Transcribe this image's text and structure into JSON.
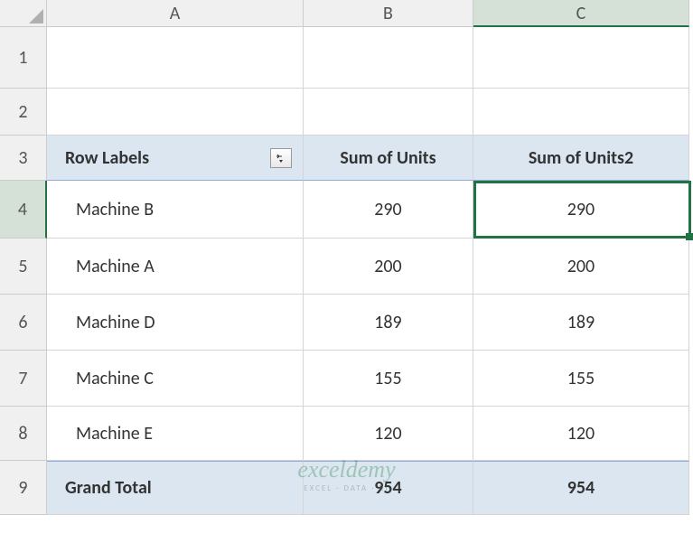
{
  "columns": [
    "A",
    "B",
    "C"
  ],
  "rows": [
    "1",
    "2",
    "3",
    "4",
    "5",
    "6",
    "7",
    "8",
    "9"
  ],
  "pivot": {
    "header": {
      "row_labels": "Row Labels",
      "col1": "Sum of Units",
      "col2": "Sum of Units2"
    },
    "data": [
      {
        "label": "Machine B",
        "v1": "290",
        "v2": "290"
      },
      {
        "label": "Machine A",
        "v1": "200",
        "v2": "200"
      },
      {
        "label": "Machine D",
        "v1": "189",
        "v2": "189"
      },
      {
        "label": "Machine C",
        "v1": "155",
        "v2": "155"
      },
      {
        "label": "Machine E",
        "v1": "120",
        "v2": "120"
      }
    ],
    "total": {
      "label": "Grand Total",
      "v1": "954",
      "v2": "954"
    }
  },
  "watermark": {
    "main": "exceldemy",
    "sub": "EXCEL · DATA · BI"
  },
  "active": {
    "row": 4,
    "col": "C"
  }
}
